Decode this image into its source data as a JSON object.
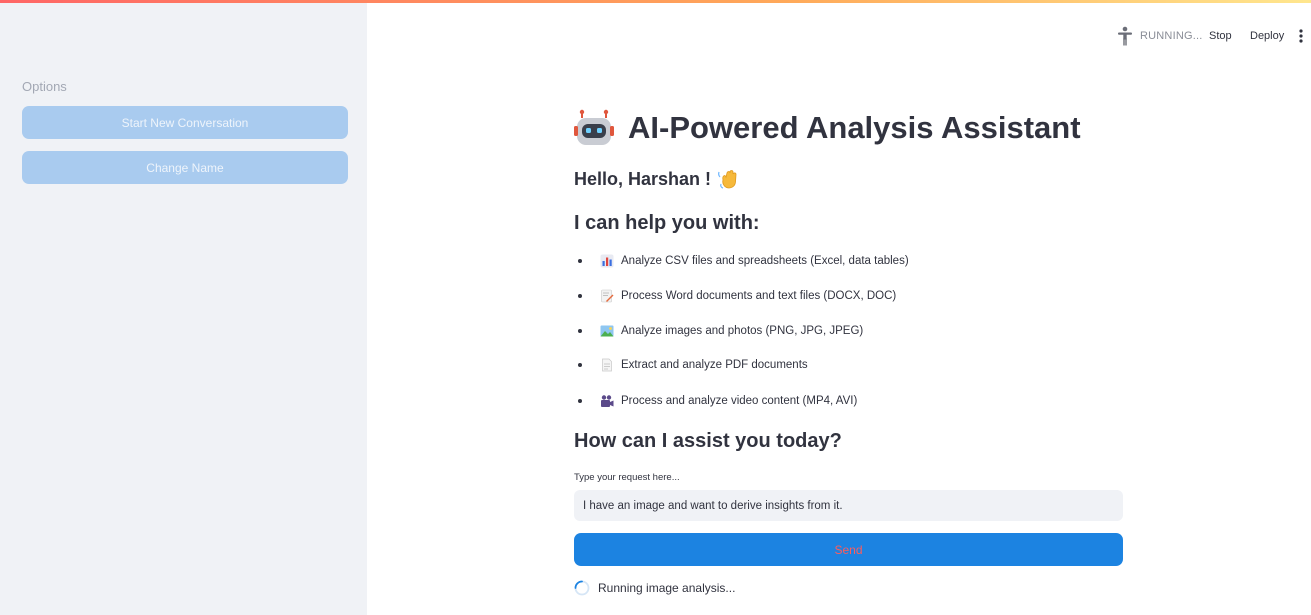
{
  "sidebar": {
    "heading": "Options",
    "buttons": [
      {
        "label": "Start New Conversation"
      },
      {
        "label": "Change Name"
      }
    ]
  },
  "header": {
    "status": "RUNNING...",
    "stop_label": "Stop",
    "deploy_label": "Deploy",
    "icons": [
      "running-person-icon",
      "more-vert-icon"
    ]
  },
  "main": {
    "title": "AI-Powered Analysis Assistant",
    "title_icon": "robot-icon",
    "greeting": "Hello, Harshan !",
    "greeting_icon": "waving-hand-icon",
    "help_heading": "I can help you with:",
    "features": [
      {
        "icon": "bar-chart-icon",
        "text": "Analyze CSV files and spreadsheets (Excel, data tables)"
      },
      {
        "icon": "memo-icon",
        "text": "Process Word documents and text files (DOCX, DOC)"
      },
      {
        "icon": "picture-icon",
        "text": "Analyze images and photos (PNG, JPG, JPEG)"
      },
      {
        "icon": "page-icon",
        "text": "Extract and analyze PDF documents"
      },
      {
        "icon": "video-camera-icon",
        "text": "Process and analyze video content (MP4, AVI)"
      }
    ],
    "assist_heading": "How can I assist you today?",
    "input": {
      "label": "Type your request here...",
      "value": "I have an image and want to derive insights from it."
    },
    "send_label": "Send",
    "spinner_text": "Running image analysis..."
  },
  "colors": {
    "accent": "#1c83e1",
    "sidebar_bg": "#f0f2f6",
    "sidebar_button": "#a9cbef",
    "send_text": "#ff5c5c"
  }
}
